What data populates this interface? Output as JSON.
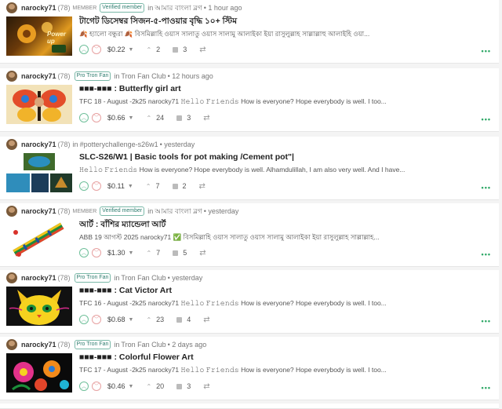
{
  "feed": {
    "posts": [
      {
        "author": "narocky71",
        "rep": "(78)",
        "label": "MEMBER",
        "badge": "Verified member",
        "prep": "in",
        "community": "আমার বাংলা ব্লগ",
        "time": "• 1 hour ago",
        "title": "টাগেট ডিসেম্বর সিজন-৫-পাওয়ার বৃদ্ধি ১০+ স্টিম",
        "snippet": "🍂 হ্যালো বন্ধুরা 🍂 বিসমিল্লাহি ওয়াস সালাতু ওয়াস সালামু আলাইকা ইয়া রাসুলুল্লাহ সাল্লাল্লাহু আলাইহি ওয়া...",
        "payout": "$0.22",
        "votes": "2",
        "comments": "3"
      },
      {
        "author": "narocky71",
        "rep": "(78)",
        "label": "",
        "badge": "Pro Tron Fan",
        "prep": "in",
        "community": "Tron Fan Club",
        "time": "• 12 hours ago",
        "title": "■■■-■■■ : Butterfly girl art",
        "snippet": "TFC 18 - August -2k25 narocky71 𝙷𝚎𝚕𝚕𝚘 𝙵𝚛𝚒𝚎𝚗𝚍𝚜 How is everyone? Hope everybody is well. I too...",
        "payout": "$0.66",
        "votes": "24",
        "comments": "3"
      },
      {
        "author": "narocky71",
        "rep": "(78)",
        "label": "",
        "badge": "",
        "prep": "in",
        "community": "#potterychallenge-s26w1",
        "time": "• yesterday",
        "title": "SLC-S26/W1 | Basic tools for pot making /Cement pot\"|",
        "snippet": "𝙷𝚎𝚕𝚕𝚘 𝙵𝚛𝚒𝚎𝚗𝚍𝚜 How is everyone? Hope everybody is well. Alhamdulillah, I am also very well. And I have...",
        "payout": "$0.11",
        "votes": "7",
        "comments": "2"
      },
      {
        "author": "narocky71",
        "rep": "(78)",
        "label": "MEMBER",
        "badge": "Verified member",
        "prep": "in",
        "community": "আমার বাংলা ব্লগ",
        "time": "• yesterday",
        "title": "আর্ট : বাঁশির ম্যান্ডেলা আর্ট",
        "snippet": "ABB 19 আগস্ট 2025 narocky71 ✅ বিসমিল্লাহি ওয়াস সালাতু ওয়াস সালামু আলাইকা ইয়া রাসুলুল্লাহ সাল্লাল্লাহ...",
        "payout": "$1.30",
        "votes": "7",
        "comments": "5"
      },
      {
        "author": "narocky71",
        "rep": "(78)",
        "label": "",
        "badge": "Pro Tron Fan",
        "prep": "in",
        "community": "Tron Fan Club",
        "time": "• yesterday",
        "title": "■■■-■■■ : Cat Victor Art",
        "snippet": "TFC 16 - August -2k25 narocky71 𝙷𝚎𝚕𝚕𝚘 𝙵𝚛𝚒𝚎𝚗𝚍𝚜 How is everyone? Hope everybody is well. I too...",
        "payout": "$0.68",
        "votes": "23",
        "comments": "4"
      },
      {
        "author": "narocky71",
        "rep": "(78)",
        "label": "",
        "badge": "Pro Tron Fan",
        "prep": "in",
        "community": "Tron Fan Club",
        "time": "• 2 days ago",
        "title": "■■■-■■■ : Colorful Flower Art",
        "snippet": "TFC 17 - August -2k25 narocky71 𝙷𝚎𝚕𝚕𝚘 𝙵𝚛𝚒𝚎𝚗𝚍𝚜 How is everyone? Hope everybody is well. I too...",
        "payout": "$0.46",
        "votes": "20",
        "comments": "3"
      }
    ]
  },
  "thumbs": {
    "post1_overlay": "Power up"
  },
  "colors": {
    "accent": "#2da866",
    "badge": "#2e7d6f"
  },
  "icons": {
    "upvote": "upvote-icon",
    "downvote": "downvote-icon",
    "caret": "caret-down-icon",
    "votes": "votes-icon",
    "comments": "comment-icon",
    "resteem": "resteem-icon",
    "more": "more-menu-icon"
  }
}
